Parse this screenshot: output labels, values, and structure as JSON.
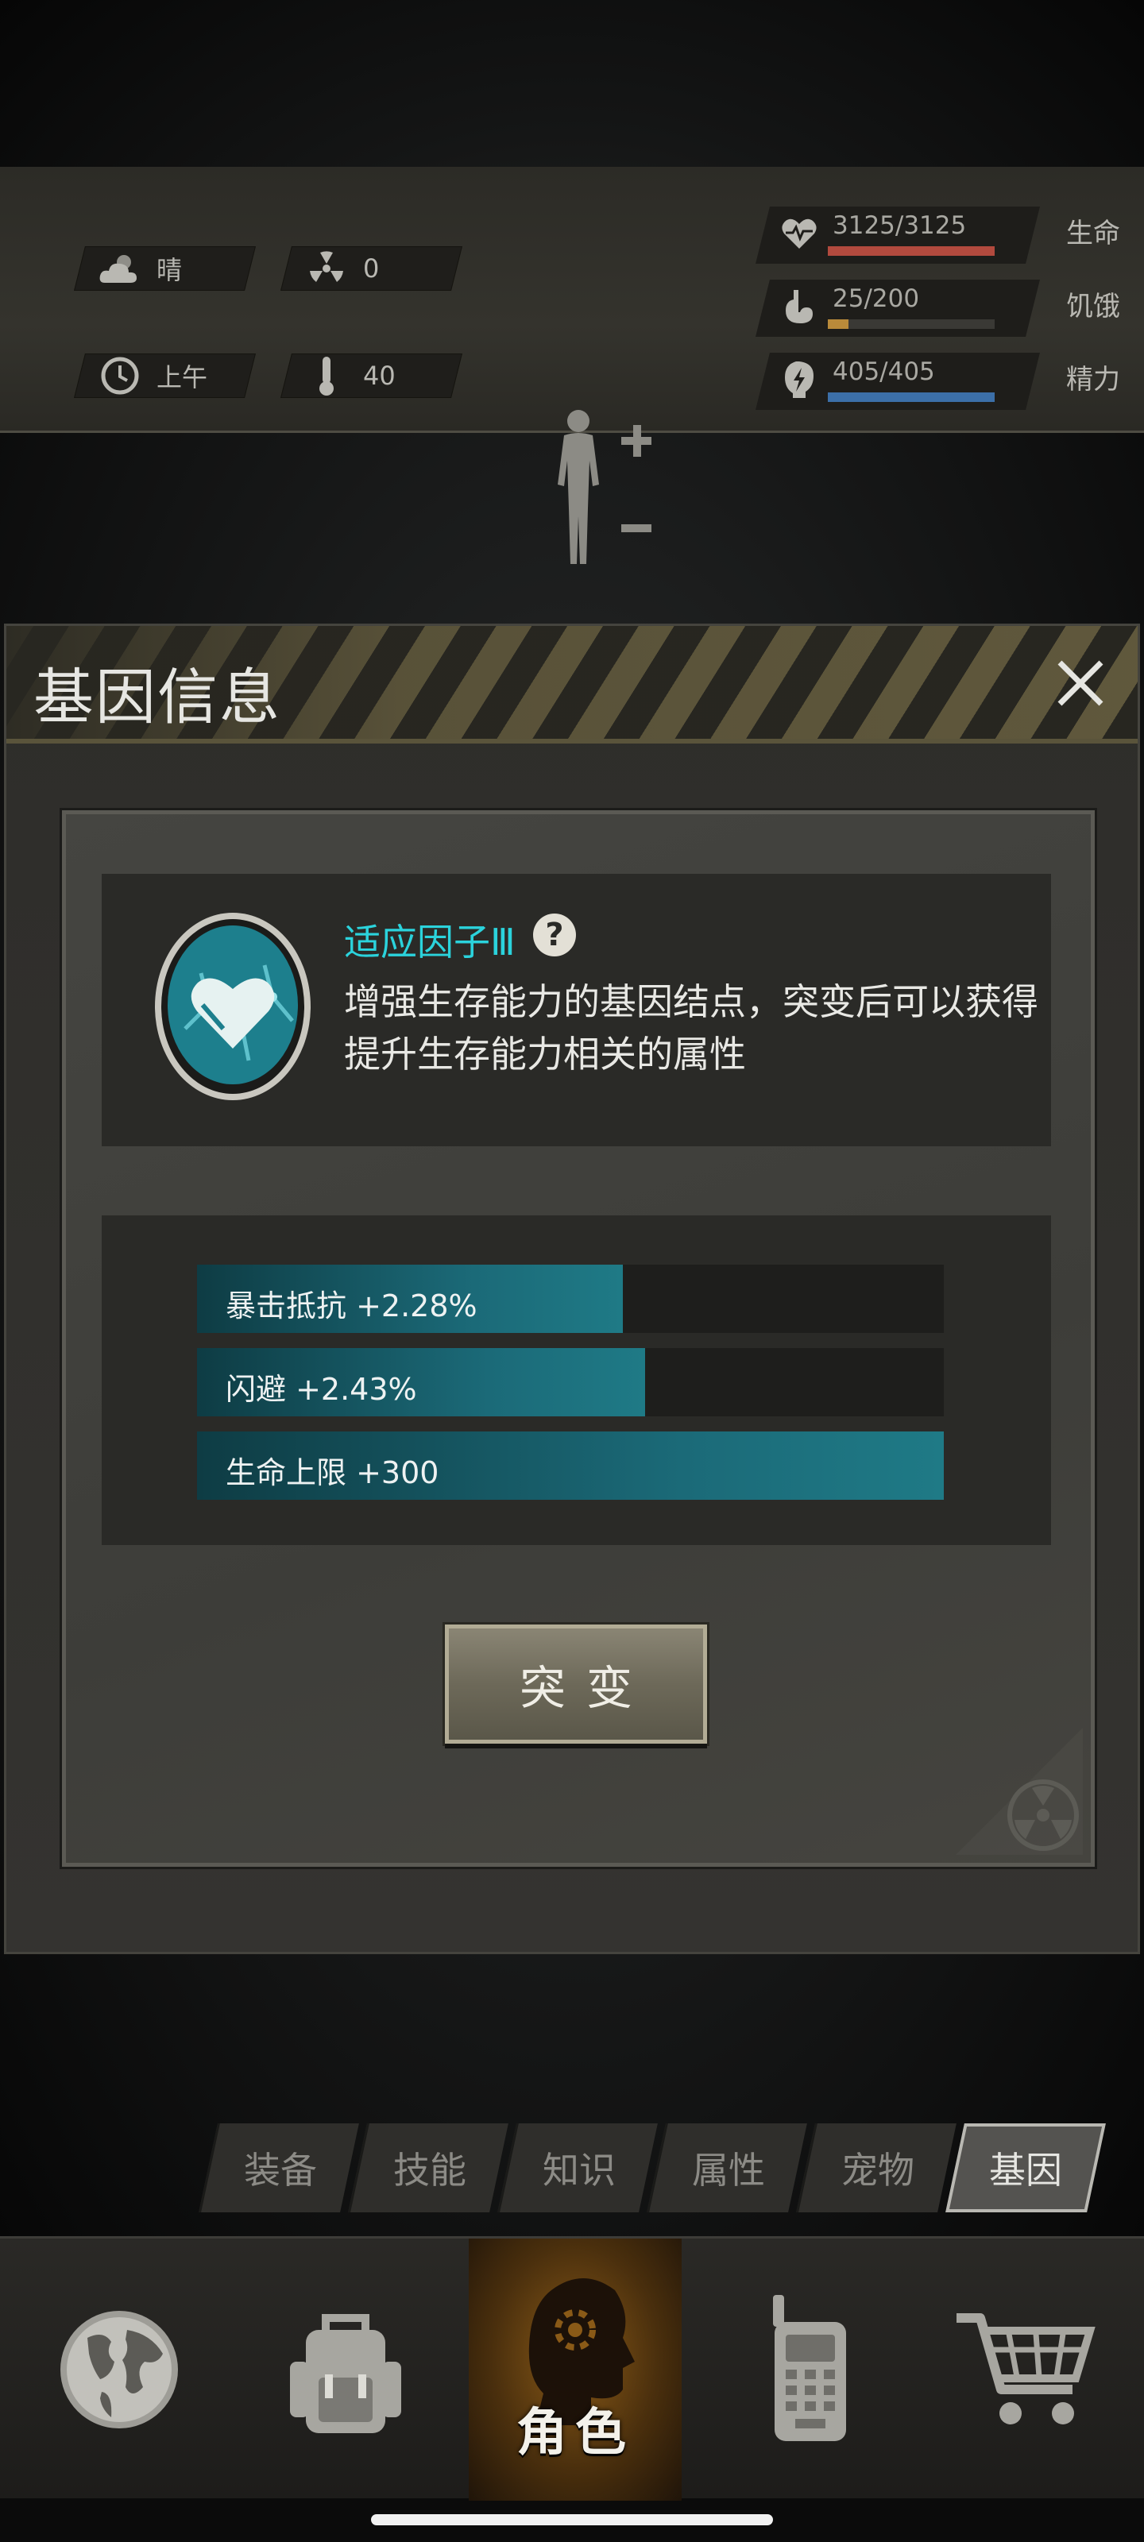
{
  "status": {
    "weather": {
      "icon": "cloud-sun-icon",
      "text": "晴"
    },
    "radiation": {
      "icon": "radiation-icon",
      "value": "0"
    },
    "time": {
      "icon": "clock-icon",
      "text": "上午"
    },
    "temperature": {
      "icon": "thermometer-icon",
      "value": "40"
    },
    "vitals": [
      {
        "icon": "heart-icon",
        "value": "3125/3125",
        "label": "生命",
        "fraction": 1.0,
        "color": "#b24a3e"
      },
      {
        "icon": "stomach-icon",
        "value": "25/200",
        "label": "饥饿",
        "fraction": 0.125,
        "color": "#b98a3a"
      },
      {
        "icon": "energy-icon",
        "value": "405/405",
        "label": "精力",
        "fraction": 1.0,
        "color": "#3c6fa8"
      }
    ]
  },
  "panel": {
    "title": "基因信息",
    "gene": {
      "name": "适应因子Ⅲ",
      "help": "?",
      "description": "增强生存能力的基因结点，突变后可以获得提升生存能力相关的属性"
    },
    "attributes": [
      {
        "text": "暴击抵抗 +2.28%",
        "fill": 0.57
      },
      {
        "text": "闪避 +2.43%",
        "fill": 0.6
      },
      {
        "text": "生命上限 +300",
        "fill": 1.0
      }
    ],
    "mutate_label": "突变"
  },
  "sub_tabs": [
    "装备",
    "技能",
    "知识",
    "属性",
    "宠物",
    "基因"
  ],
  "active_sub_tab": "基因",
  "bottom_nav": {
    "items": [
      "globe-icon",
      "backpack-icon",
      "character-icon",
      "radio-icon",
      "cart-icon"
    ],
    "active_label": "角色"
  },
  "colors": {
    "accent_cyan": "#2bd3dc",
    "bar_teal": "#1f7a86",
    "active_orange": "#8a5a17"
  }
}
